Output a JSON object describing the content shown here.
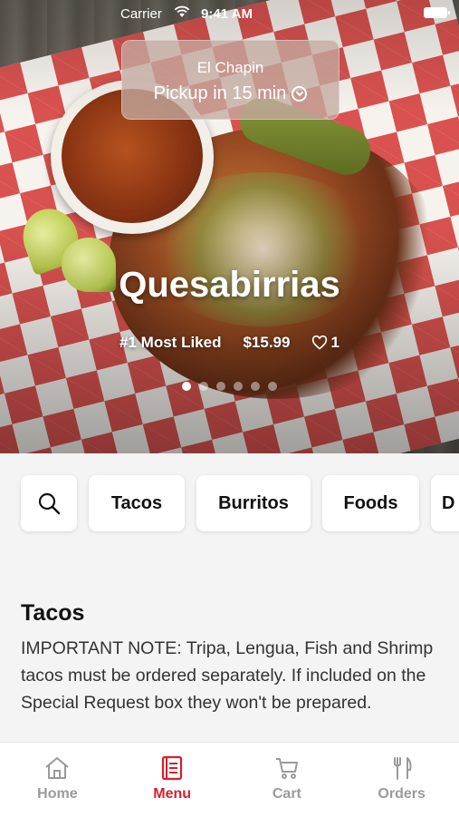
{
  "status_bar": {
    "carrier": "Carrier",
    "time": "9:41 AM"
  },
  "pickup": {
    "store": "El Chapin",
    "label": "Pickup in 15 min"
  },
  "hero": {
    "title": "Quesabirrias",
    "badge": "#1 Most Liked",
    "price": "$15.99",
    "likes": "1",
    "slides": 6,
    "active_slide": 0
  },
  "categories": [
    "Tacos",
    "Burritos",
    "Foods",
    "D"
  ],
  "section": {
    "title": "Tacos",
    "note": "IMPORTANT NOTE: Tripa, Lengua, Fish and Shrimp tacos must be ordered separately. If included on the Special Request box they won't be prepared."
  },
  "tabs": [
    {
      "label": "Home",
      "icon": "home-icon"
    },
    {
      "label": "Menu",
      "icon": "menu-icon"
    },
    {
      "label": "Cart",
      "icon": "cart-icon"
    },
    {
      "label": "Orders",
      "icon": "orders-icon"
    }
  ],
  "active_tab": "Menu",
  "colors": {
    "accent": "#d71f2b",
    "inactive": "#9a9a9a"
  }
}
